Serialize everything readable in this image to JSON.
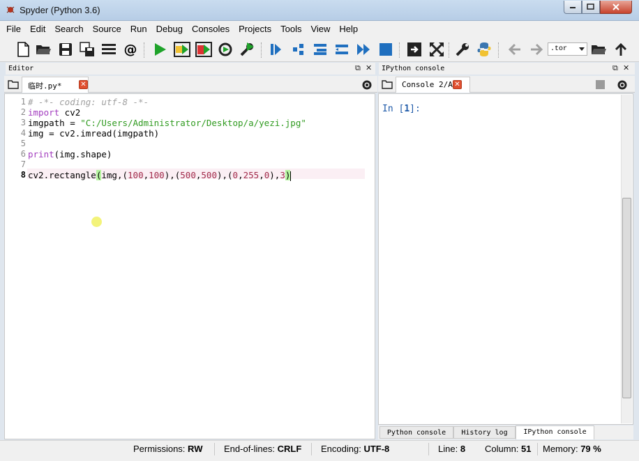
{
  "window": {
    "title": "Spyder (Python 3.6)"
  },
  "menu": [
    "File",
    "Edit",
    "Search",
    "Source",
    "Run",
    "Debug",
    "Consoles",
    "Projects",
    "Tools",
    "View",
    "Help"
  ],
  "toolbar": {
    "cwd_value": ".tor"
  },
  "editor": {
    "pane_title": "Editor",
    "tab_label": "临时.py*",
    "current_line": 8,
    "line_numbers": [
      "1",
      "2",
      "3",
      "4",
      "5",
      "6",
      "7",
      "8"
    ],
    "lines": [
      "# -*- coding: utf-8 -*-",
      "import cv2",
      "imgpath = \"C:/Users/Administrator/Desktop/a/yezi.jpg\"",
      "img = cv2.imread(imgpath)",
      "",
      "print(img.shape)",
      "",
      "cv2.rectangle(img,(100,100),(500,500),(0,255,0),3)"
    ]
  },
  "console": {
    "pane_title": "IPython console",
    "tab_label": "Console 2/A",
    "prompt": "In [1]:",
    "bottom_tabs": [
      "Python console",
      "History log",
      "IPython console"
    ]
  },
  "status": {
    "permissions_label": "Permissions:",
    "permissions": "RW",
    "eol_label": "End-of-lines:",
    "eol": "CRLF",
    "encoding_label": "Encoding:",
    "encoding": "UTF-8",
    "line_label": "Line:",
    "line": "8",
    "column_label": "Column:",
    "column": "51",
    "memory_label": "Memory:",
    "memory": "79 %"
  },
  "colors": {
    "run_green": "#1fa32a",
    "python_blue": "#3a76b0",
    "accent_red": "#e04f2f"
  }
}
